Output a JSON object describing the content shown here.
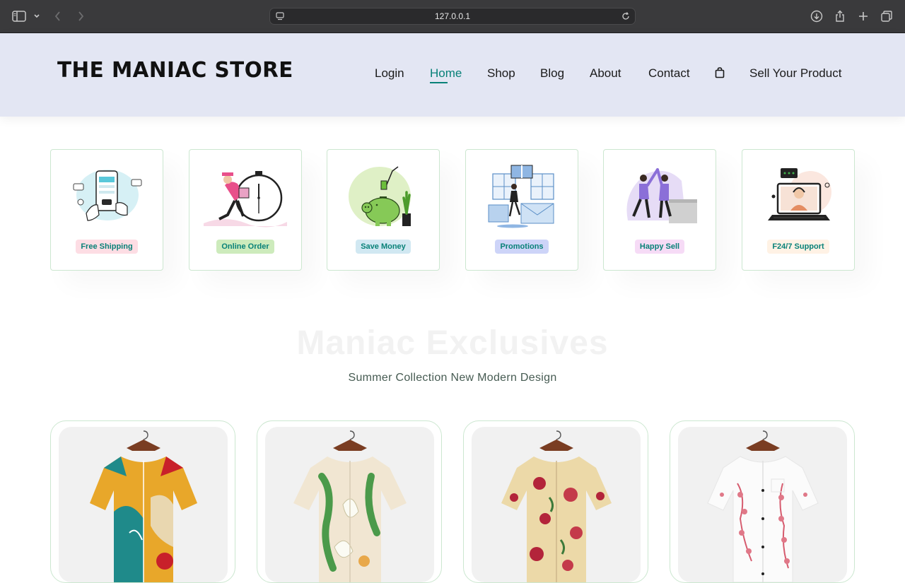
{
  "browser": {
    "url": "127.0.0.1"
  },
  "header": {
    "logo": "THE MANIAC STORE",
    "nav": [
      {
        "label": "Login"
      },
      {
        "label": "Home"
      },
      {
        "label": "Shop"
      },
      {
        "label": "Blog"
      },
      {
        "label": "About"
      },
      {
        "label": "Contact"
      },
      {
        "label": "Sell Your Product"
      }
    ],
    "active_nav": "Home",
    "cart_icon": "shopping-bag-icon"
  },
  "features": [
    {
      "label": "Free Shipping",
      "tag_color": "#fddde4",
      "illustration": "phone-payment"
    },
    {
      "label": "Online Order",
      "tag_color": "#cdebbc",
      "illustration": "clock-delivery"
    },
    {
      "label": "Save Money",
      "tag_color": "#d1e8f2",
      "illustration": "piggy-bank"
    },
    {
      "label": "Promotions",
      "tag_color": "#cdd4f8",
      "illustration": "gift-envelope"
    },
    {
      "label": "Happy Sell",
      "tag_color": "#f6dbf6",
      "illustration": "high-five"
    },
    {
      "label": "F24/7 Support",
      "tag_color": "#fff2e5",
      "illustration": "laptop-support"
    }
  ],
  "exclusives": {
    "title": "Maniac Exclusives",
    "subtitle": "Summer Collection New Modern Design"
  },
  "products": [
    {
      "image": "shirt-abstract-colorful"
    },
    {
      "image": "shirt-floral-green"
    },
    {
      "image": "shirt-floral-red"
    },
    {
      "image": "shirt-floral-pink-white"
    }
  ],
  "colors": {
    "accent": "#088178",
    "header_bg": "#e3e6f3",
    "card_border": "#cce7d0"
  }
}
